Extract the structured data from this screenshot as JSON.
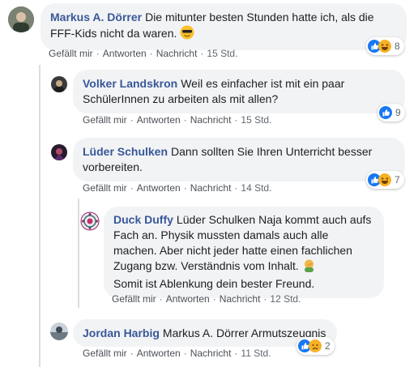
{
  "comments": [
    {
      "author": "Markus A. Dörrer",
      "text": "Die mitunter besten Stunden hatte ich, als die FFF-Kids nicht da waren.",
      "emoji": "cool-face-emoji",
      "actions": {
        "like": "Gefällt mir",
        "reply": "Antworten",
        "message": "Nachricht",
        "time": "15 Std."
      },
      "reactions": {
        "icons": [
          "like-icon",
          "haha-icon"
        ],
        "count": "8"
      }
    },
    {
      "author": "Volker Landskron",
      "text": "Weil es einfacher ist mit ein paar SchülerInnen zu arbeiten als mit allen?",
      "actions": {
        "like": "Gefällt mir",
        "reply": "Antworten",
        "message": "Nachricht",
        "time": "15 Std."
      },
      "reactions": {
        "icons": [
          "like-icon"
        ],
        "count": "9"
      }
    },
    {
      "author": "Lüder Schulken",
      "text": "Dann sollten Sie Ihren Unterricht besser vorbereiten.",
      "actions": {
        "like": "Gefällt mir",
        "reply": "Antworten",
        "message": "Nachricht",
        "time": "14 Std."
      },
      "reactions": {
        "icons": [
          "like-icon",
          "haha-icon"
        ],
        "count": "7"
      }
    },
    {
      "author": "Duck Duffy",
      "text": "Lüder Schulken Naja kommt auch aufs Fach an. Physik mussten damals auch alle machen. Aber nicht jeder hatte einen fachlichen Zugang bzw. Verständnis vom Inhalt.",
      "text2": "Somit ist Ablenkung dein bester Freund.",
      "emoji": "facepalm-emoji",
      "actions": {
        "like": "Gefällt mir",
        "reply": "Antworten",
        "message": "Nachricht",
        "time": "12 Std."
      }
    },
    {
      "author": "Jordan Harbig",
      "text": "Markus A. Dörrer Armutszeugnis",
      "actions": {
        "like": "Gefällt mir",
        "reply": "Antworten",
        "message": "Nachricht",
        "time": "11 Std."
      },
      "reactions": {
        "icons": [
          "like-icon",
          "sad-icon"
        ],
        "count": "2"
      }
    }
  ],
  "colors": {
    "link": "#385898",
    "bubble": "#f2f3f5",
    "like": "#1877f2",
    "haha": "#f7b125"
  }
}
